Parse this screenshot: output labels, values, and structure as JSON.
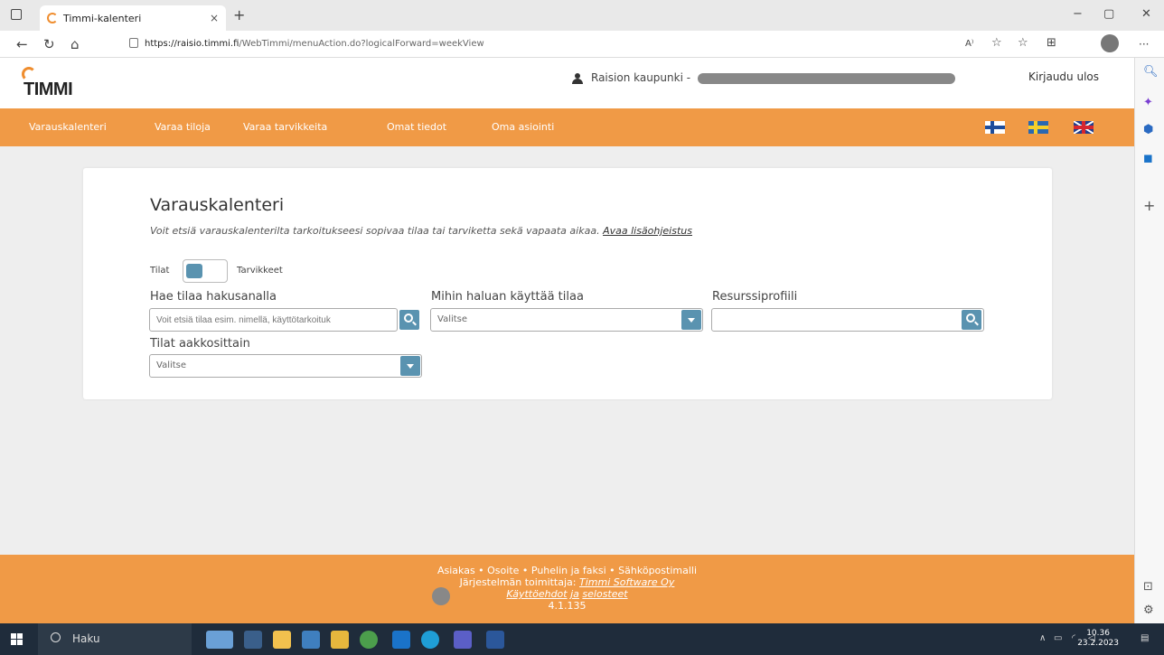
{
  "browser": {
    "tab_title": "Timmi-kalenteri",
    "tab_close": "×",
    "new_tab": "+",
    "url_domain": "https://raisio.timmi.fi",
    "url_path": "/WebTimmi/menuAction.do?logicalForward=weekView",
    "minimize": "−",
    "restore": "▢",
    "close": "✕",
    "more": "···",
    "read_aloud": "A⁾",
    "add_favorite": "☆",
    "favorites": "☆",
    "collections": "⊞"
  },
  "header": {
    "logo": "TIMMI",
    "organization": "Raision kaupunki -",
    "logout": "Kirjaudu ulos"
  },
  "nav": {
    "items": [
      "Varauskalenteri",
      "Varaa tiloja",
      "Varaa tarvikkeita",
      "Omat tiedot",
      "Oma asiointi"
    ]
  },
  "card": {
    "title": "Varauskalenteri",
    "description": "Voit etsiä varauskalenterilta tarkoitukseesi sopivaa tilaa tai tarviketta sekä vapaata aikaa.",
    "help_link": "Avaa lisäohjeistus",
    "toggle_left": "Tilat",
    "toggle_right": "Tarvikkeet",
    "search_label": "Hae tilaa hakusanalla",
    "search_placeholder": "Voit etsiä tilaa esim. nimellä, käyttötarkoituk",
    "purpose_label": "Mihin haluan käyttää tilaa",
    "purpose_value": "Valitse",
    "profile_label": "Resurssiprofiili",
    "profile_value": "",
    "alpha_label": "Tilat aakkosittain",
    "alpha_value": "Valitse"
  },
  "footer": {
    "line1": "Asiakas • Osoite • Puhelin ja faksi • Sähköpostimalli",
    "line2_prefix": "Järjestelmän toimittaja:",
    "line2_link": "Timmi Software Oy",
    "line3_link1": "Käyttöehdot",
    "line3_mid": "ja",
    "line3_link2": "selosteet",
    "version": "4.1.135"
  },
  "taskbar": {
    "search": "Haku",
    "time": "10.36",
    "date": "23.2.2023"
  },
  "colors": {
    "brand_orange": "#f09a46",
    "accent_blue": "#5a93b0"
  }
}
